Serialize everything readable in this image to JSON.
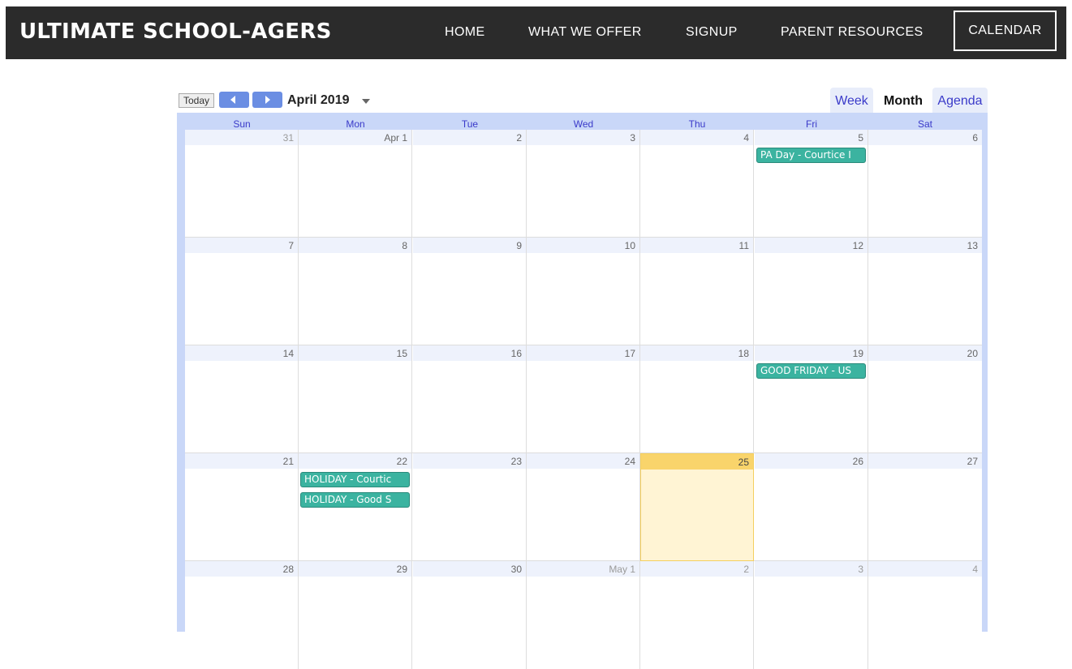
{
  "site": {
    "brand": "ULTIMATE SCHOOL-AGERS"
  },
  "nav": {
    "home": "HOME",
    "offer": "WHAT WE OFFER",
    "signup": "SIGNUP",
    "parent": "PARENT RESOURCES",
    "calendar": "CALENDAR"
  },
  "toolbar": {
    "today": "Today",
    "month_title": "April 2019"
  },
  "views": {
    "week": "Week",
    "month": "Month",
    "agenda": "Agenda",
    "active": "Month"
  },
  "weekdays": [
    "Sun",
    "Mon",
    "Tue",
    "Wed",
    "Thu",
    "Fri",
    "Sat"
  ],
  "weeks": [
    [
      "31",
      "Apr 1",
      "2",
      "3",
      "4",
      "5",
      "6"
    ],
    [
      "7",
      "8",
      "9",
      "10",
      "11",
      "12",
      "13"
    ],
    [
      "14",
      "15",
      "16",
      "17",
      "18",
      "19",
      "20"
    ],
    [
      "21",
      "22",
      "23",
      "24",
      "25",
      "26",
      "27"
    ],
    [
      "28",
      "29",
      "30",
      "May 1",
      "2",
      "3",
      "4"
    ]
  ],
  "events": {
    "apr5": "PA Day - Courtice I",
    "apr19": "GOOD FRIDAY - US",
    "apr22a": "HOLIDAY - Courtic",
    "apr22b": "HOLIDAY - Good S"
  },
  "colors": {
    "navbar": "#2b2b2b",
    "event": "#3bb3a0",
    "today": "#fff4d4",
    "accent": "#6b8ee3"
  }
}
